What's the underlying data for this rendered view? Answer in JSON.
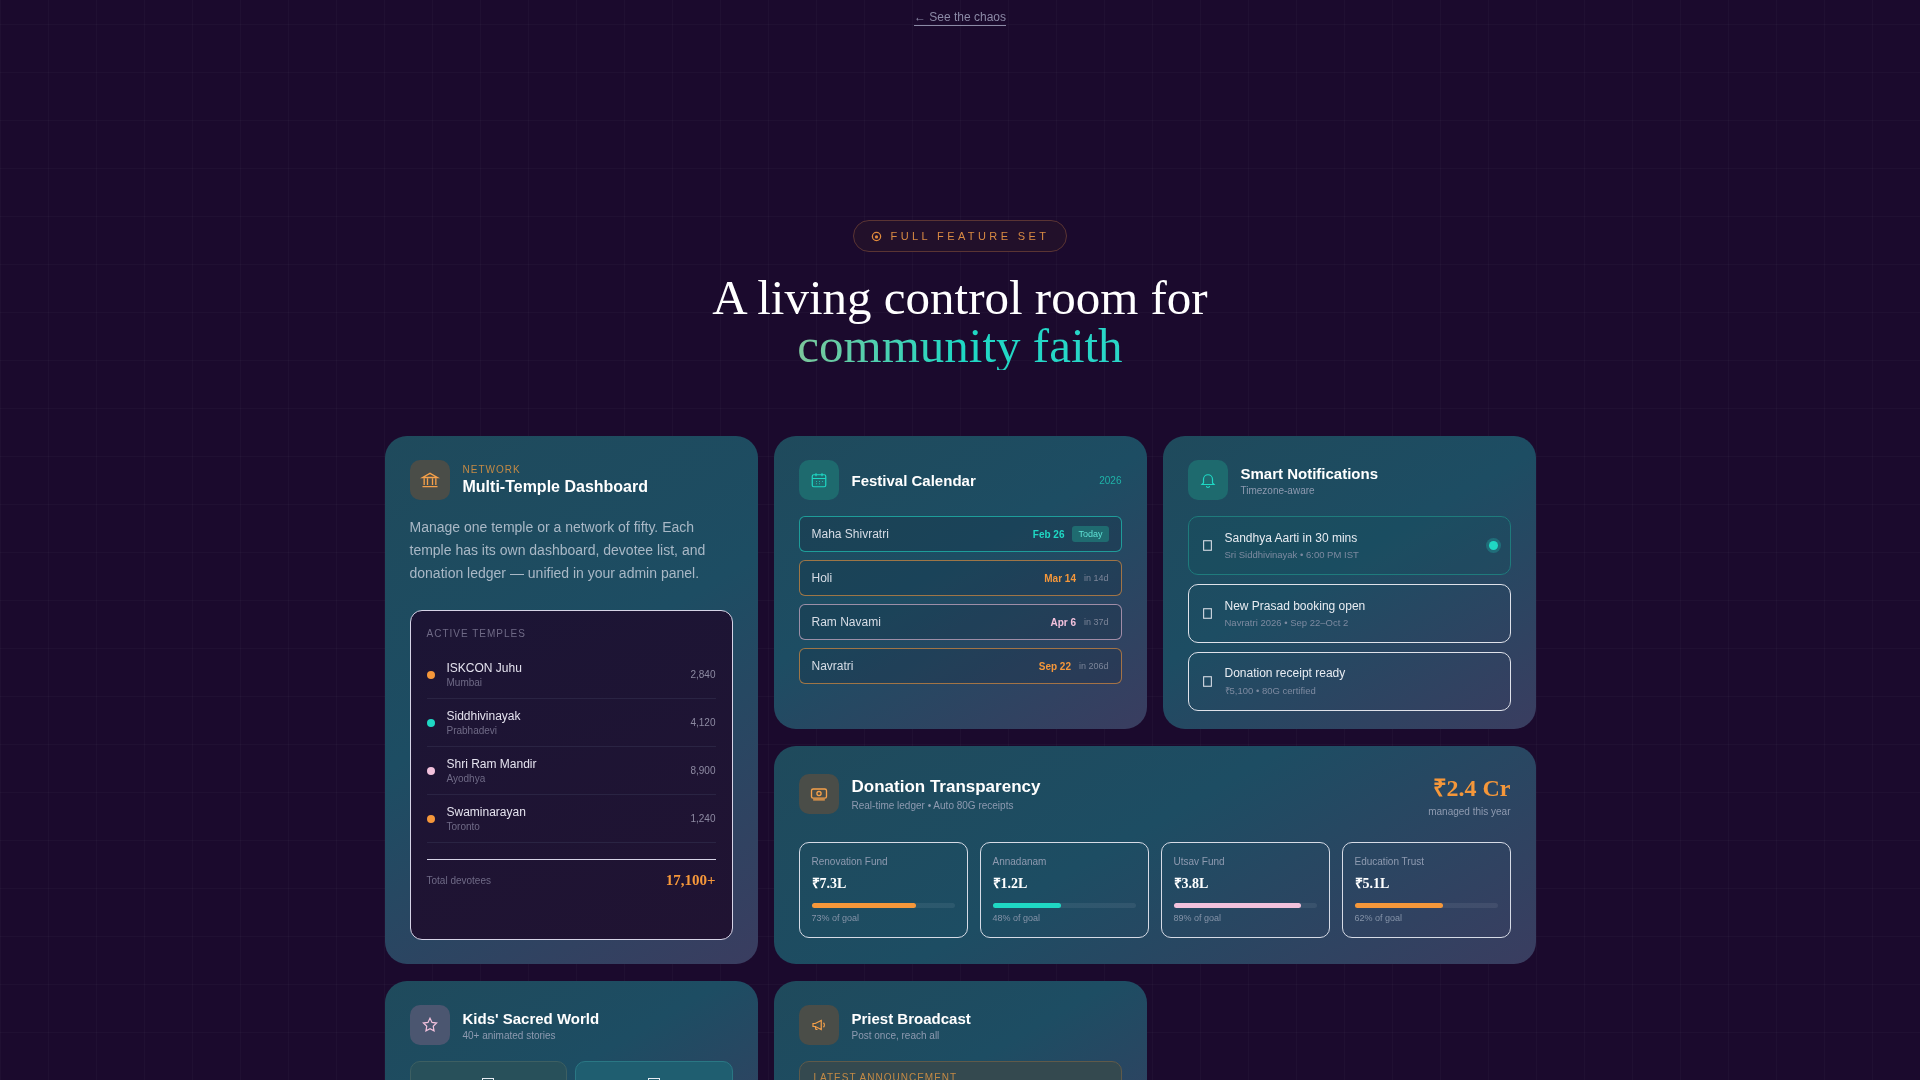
{
  "back_link": "← See the chaos",
  "eyebrow": "FULL FEATURE SET",
  "headline": {
    "line1": "A living control room for",
    "line2": "community faith"
  },
  "temple_card": {
    "label": "NETWORK",
    "title": "Multi-Temple Dashboard",
    "description": "Manage one temple or a network of fifty. Each temple has its own dashboard, devotee list, and donation ledger — unified in your admin panel.",
    "list_title": "ACTIVE TEMPLES",
    "temples": [
      {
        "name": "ISKCON Juhu",
        "city": "Mumbai",
        "count": "2,840",
        "color": "#f5973a"
      },
      {
        "name": "Siddhivinayak",
        "city": "Prabhadevi",
        "count": "4,120",
        "color": "#1fd8c4"
      },
      {
        "name": "Shri Ram Mandir",
        "city": "Ayodhya",
        "count": "8,900",
        "color": "#f2c1dc"
      },
      {
        "name": "Swaminarayan",
        "city": "Toronto",
        "count": "1,240",
        "color": "#f5973a"
      }
    ],
    "total_label": "Total devotees",
    "total_value": "17,100+"
  },
  "calendar_card": {
    "title": "Festival Calendar",
    "year": "2026",
    "festivals": [
      {
        "name": "Maha Shivratri",
        "date": "Feb 26",
        "tag": "Today",
        "kind": "today",
        "color": "#1fd8c4"
      },
      {
        "name": "Holi",
        "date": "Mar 14",
        "tag": "in 14d",
        "kind": "upcoming",
        "color": "#f5973a"
      },
      {
        "name": "Ram Navami",
        "date": "Apr 6",
        "tag": "in 37d",
        "kind": "upcoming",
        "color": "#f2c1dc"
      },
      {
        "name": "Navratri",
        "date": "Sep 22",
        "tag": "in 206d",
        "kind": "upcoming",
        "color": "#f5973a"
      }
    ]
  },
  "notifications_card": {
    "title": "Smart Notifications",
    "subtitle": "Timezone-aware",
    "notifications": [
      {
        "title": "Sandhya Aarti in 30 mins",
        "detail": "Sri Siddhivinayak • 6:00 PM IST",
        "unread": true
      },
      {
        "title": "New Prasad booking open",
        "detail": "Navratri 2026 • Sep 22–Oct 2",
        "unread": false
      },
      {
        "title": "Donation receipt ready",
        "detail": "₹5,100 • 80G certified",
        "unread": false
      }
    ]
  },
  "donation_card": {
    "title": "Donation Transparency",
    "subtitle": "Real-time ledger • Auto 80G receipts",
    "total": "₹2.4 Cr",
    "total_caption": "managed this year",
    "funds": [
      {
        "name": "Renovation Fund",
        "amount": "₹7.3L",
        "level": 0.73,
        "progress": "73% of goal",
        "color": "#f5973a"
      },
      {
        "name": "Annadanam",
        "amount": "₹1.2L",
        "level": 0.48,
        "progress": "48% of goal",
        "color": "#1fd8c4"
      },
      {
        "name": "Utsav Fund",
        "amount": "₹3.8L",
        "level": 0.89,
        "progress": "89% of goal",
        "color": "#f2c1dc"
      },
      {
        "name": "Education Trust",
        "amount": "₹5.1L",
        "level": 0.62,
        "progress": "62% of goal",
        "color": "#f5973a"
      }
    ]
  },
  "kids_card": {
    "title": "Kids' Sacred World",
    "subtitle": "40+ animated stories"
  },
  "broadcast_card": {
    "title": "Priest Broadcast",
    "subtitle": "Post once, reach all",
    "announcement_label": "LATEST ANNOUNCEMENT"
  }
}
